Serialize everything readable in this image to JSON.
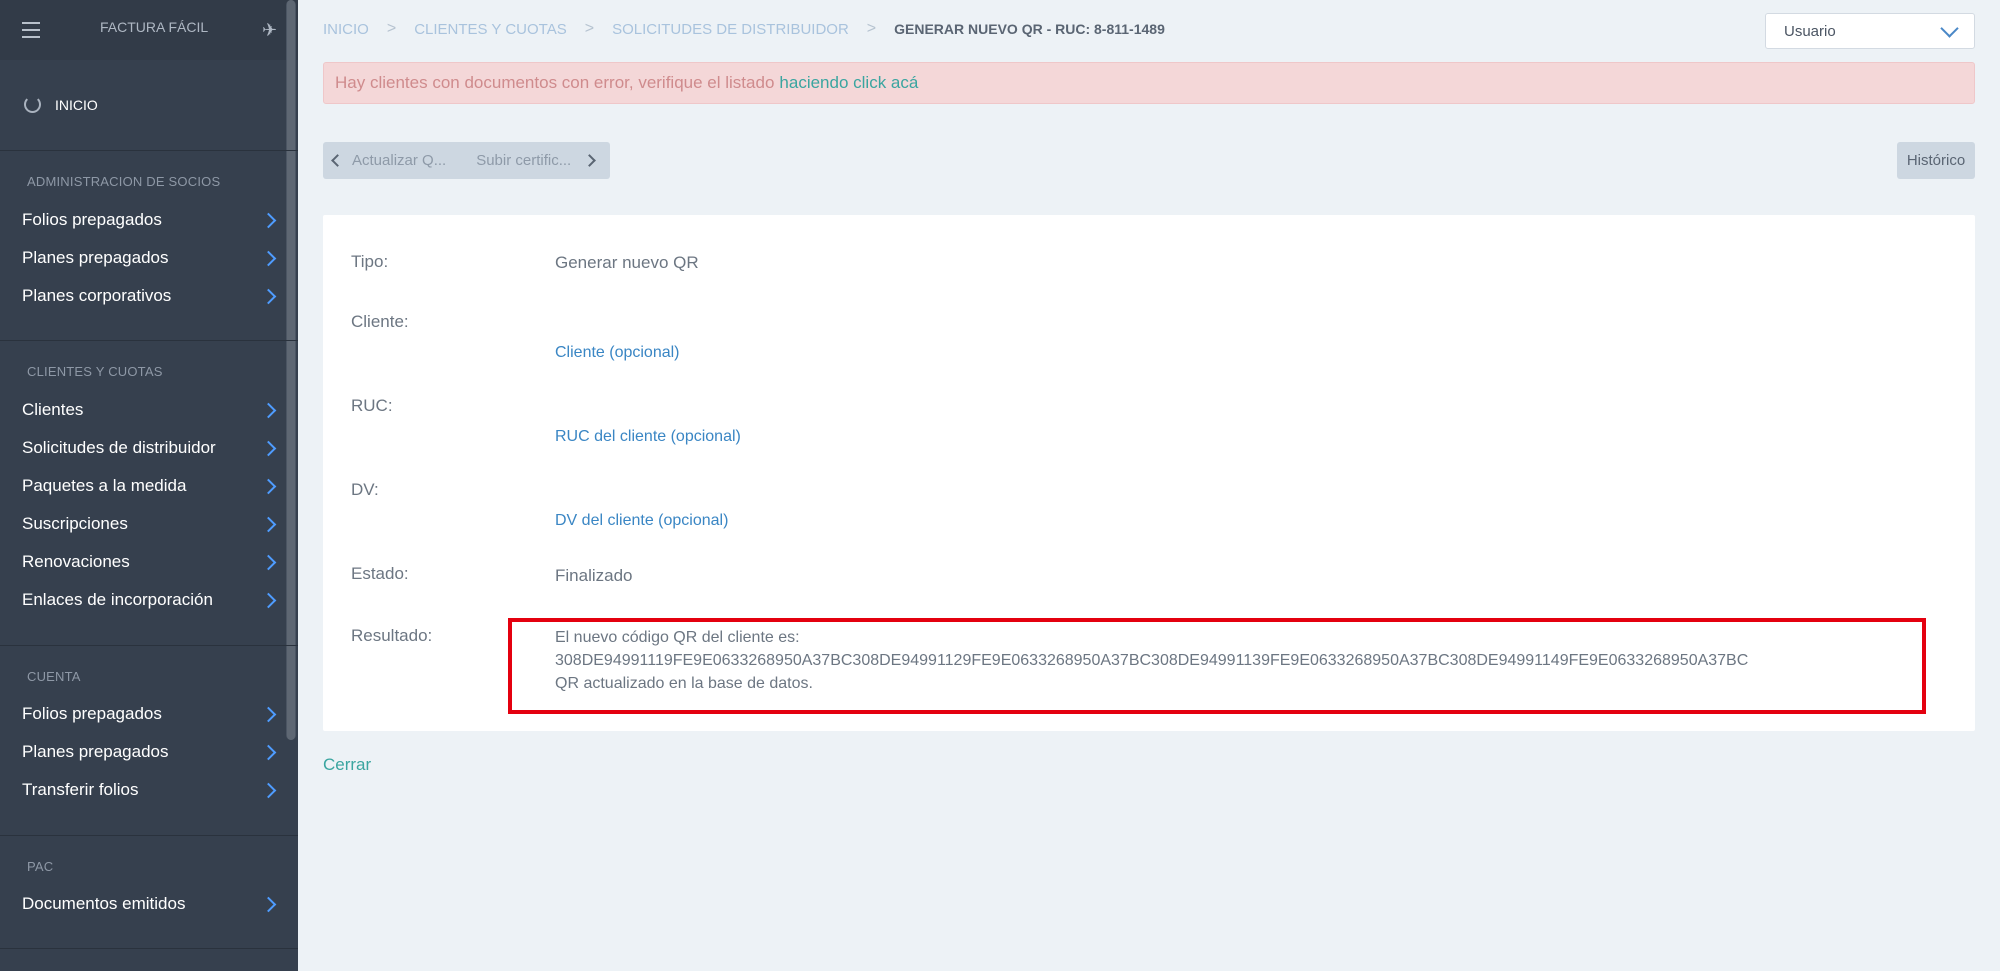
{
  "sidebar": {
    "brand": "FACTURA FÁCIL",
    "home": "INICIO",
    "sections": [
      {
        "title": "ADMINISTRACION DE SOCIOS",
        "items": [
          "Folios prepagados",
          "Planes prepagados",
          "Planes corporativos"
        ]
      },
      {
        "title": "CLIENTES Y CUOTAS",
        "items": [
          "Clientes",
          "Solicitudes de distribuidor",
          "Paquetes a la medida",
          "Suscripciones",
          "Renovaciones",
          "Enlaces de incorporación"
        ]
      },
      {
        "title": "CUENTA",
        "items": [
          "Folios prepagados",
          "Planes prepagados",
          "Transferir folios"
        ]
      },
      {
        "title": "PAC",
        "items": [
          "Documentos emitidos"
        ]
      }
    ]
  },
  "breadcrumb": [
    "INICIO",
    "CLIENTES Y CUOTAS",
    "SOLICITUDES DE DISTRIBUIDOR"
  ],
  "breadcrumb_current": "GENERAR NUEVO QR - RUC: 8-811-1489",
  "user_select": "Usuario",
  "alert": {
    "text": "Hay clientes con documentos con error, verifique el listado",
    "link": "haciendo click acá"
  },
  "pager": {
    "prev_step": "Actualizar Q...",
    "next_step": "Subir certific..."
  },
  "historico": "Histórico",
  "details": {
    "tipo_label": "Tipo:",
    "tipo_value": "Generar nuevo QR",
    "cliente_label": "Cliente:",
    "cliente_value": "Cliente (opcional)",
    "ruc_label": "RUC:",
    "ruc_value": "RUC del cliente (opcional)",
    "dv_label": "DV:",
    "dv_value": "DV del cliente (opcional)",
    "estado_label": "Estado:",
    "estado_value": "Finalizado",
    "resultado_label": "Resultado:",
    "resultado_line1": "El nuevo código QR del cliente es:",
    "resultado_line2": "308DE94991119FE9E0633268950A37BC308DE94991129FE9E0633268950A37BC308DE94991139FE9E0633268950A37BC308DE94991149FE9E0633268950A37BC",
    "resultado_line3": "QR actualizado en la base de datos."
  },
  "cerrar": "Cerrar",
  "colors": {
    "sidebar_bg": "#36404e",
    "accent_link": "#3a86c4",
    "teal": "#3aa5a0",
    "alert_bg": "#f4d7d8",
    "highlight": "#e4000f"
  }
}
